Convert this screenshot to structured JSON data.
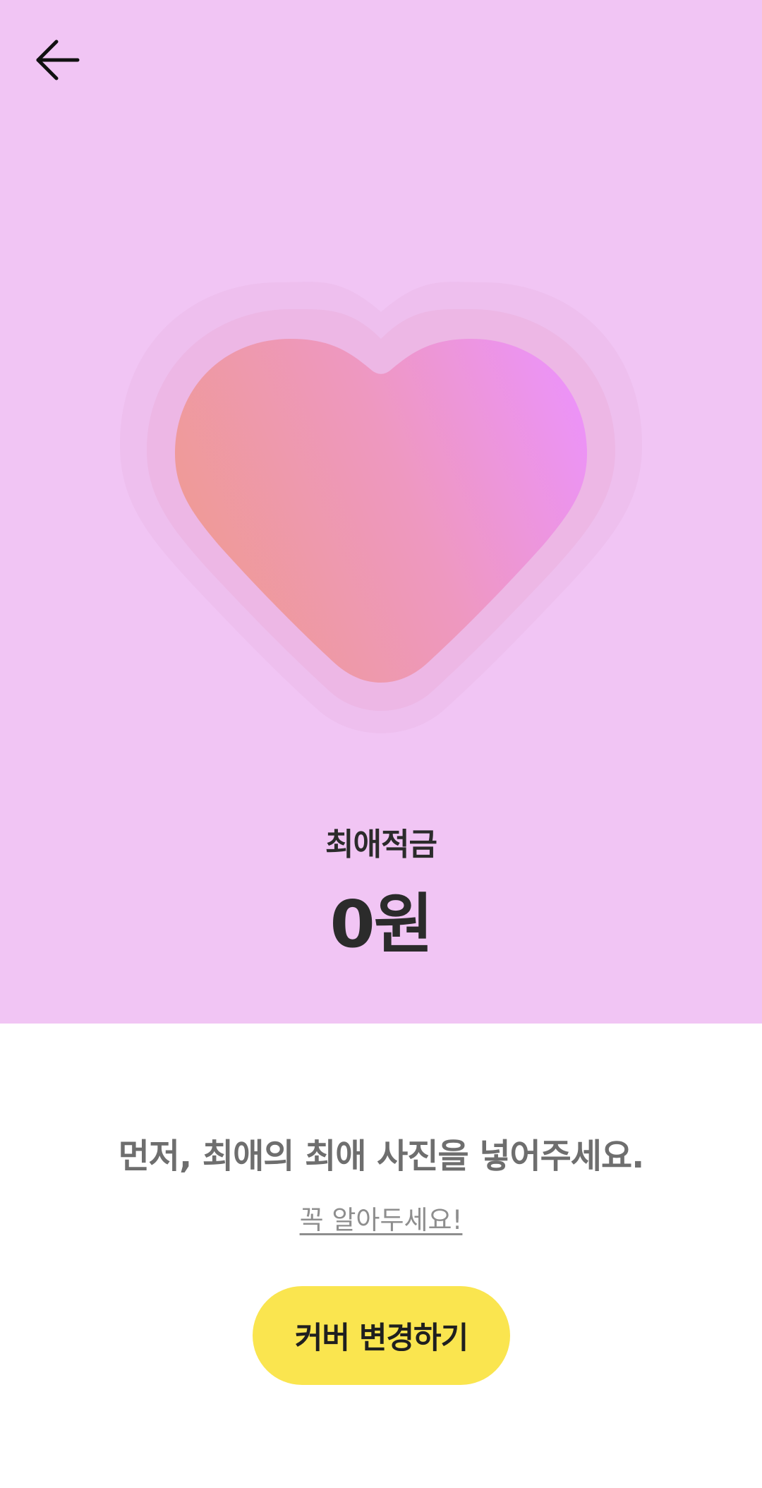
{
  "header": {
    "back_icon": "arrow-left-icon"
  },
  "hero": {
    "background_color": "#f1c5f4",
    "heart_icon": "heart-icon",
    "heart_gradient": [
      "#ef9a93",
      "#ec93f7"
    ],
    "title": "최애적금",
    "amount": "0원"
  },
  "content": {
    "instruction": "먼저, 최애의 최애 사진을 넣어주세요.",
    "notice_link": "꼭 알아두세요!",
    "cover_button_label": "커버 변경하기",
    "cover_button_color": "#fae54f"
  }
}
